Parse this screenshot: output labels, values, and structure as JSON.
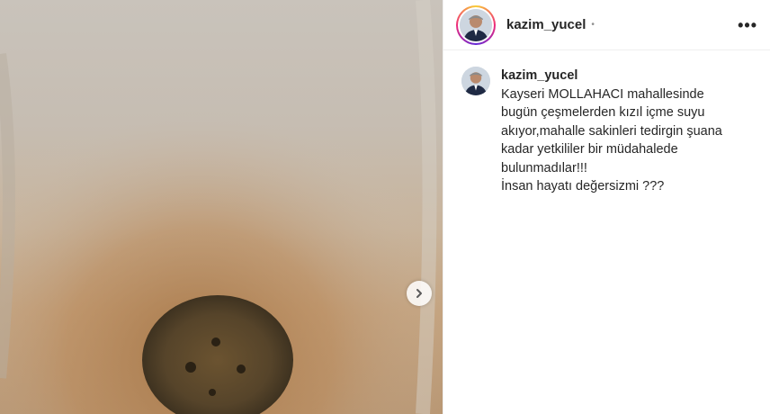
{
  "post": {
    "username": "kazim_yucel",
    "header_dot": "•",
    "more_label": "•••",
    "caption": "Kayseri MOLLAHACI mahallesinde\nbugün çeşmelerden kızıl içme suyu\nakıyor,mahalle sakinleri tedirgin şuana\nkadar yetkililer bir müdahalede\nbulunmadılar!!!\nİnsan hayatı değersizmi ???",
    "icons": {
      "next": "chevron-right-icon",
      "more": "more-options-icon",
      "avatar": "profile-avatar"
    },
    "colors": {
      "story_ring": [
        "#f9ce34",
        "#ee2a7b",
        "#6228d7"
      ],
      "text": "#262626"
    }
  }
}
